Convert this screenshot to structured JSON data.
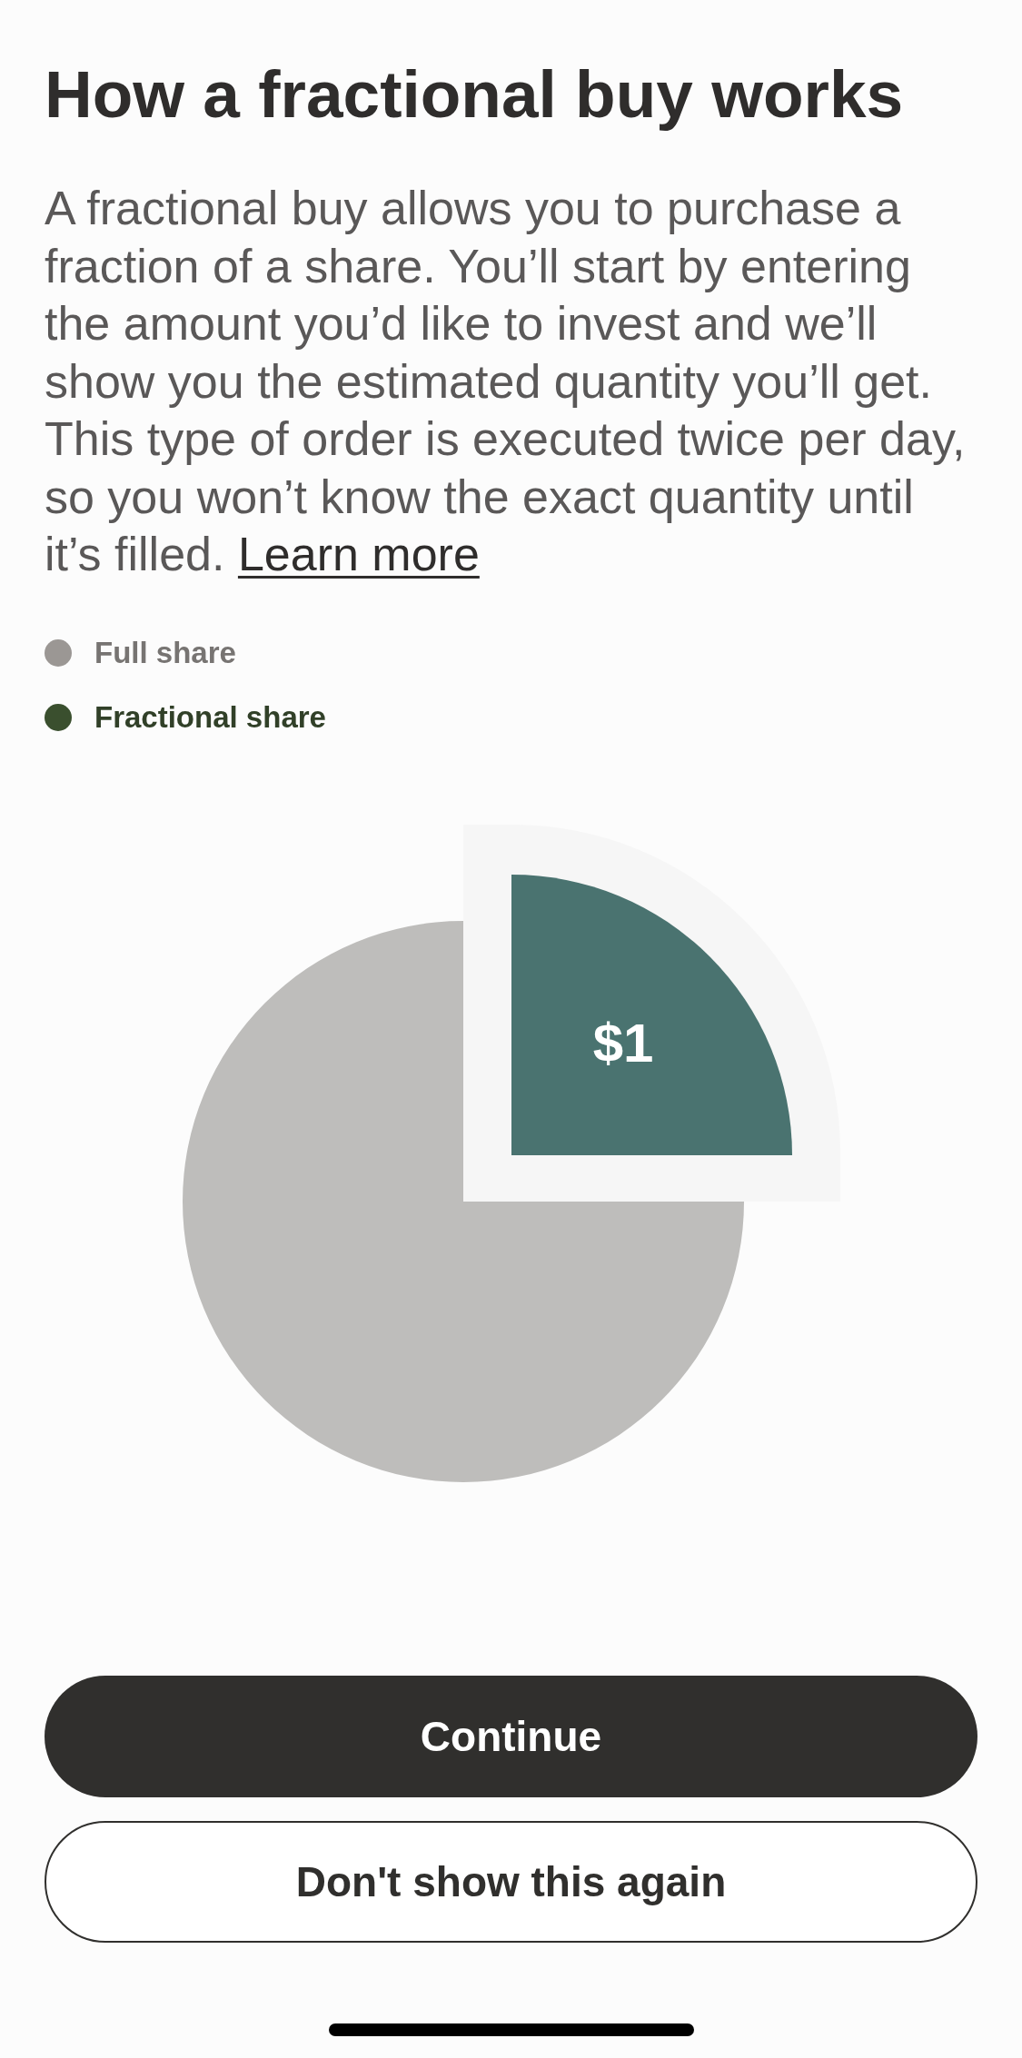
{
  "title": "How a fractional buy works",
  "description": {
    "text": "A fractional buy allows you to purchase a fraction of a share. You’ll start by entering the amount you’d like to invest and we’ll show you the estimated quantity you’ll get. This type of order is executed twice per day, so you won’t know the exact quantity until it’s filled.",
    "link": "Learn more"
  },
  "legend": [
    {
      "label": "Full share",
      "color": "#9b9794"
    },
    {
      "label": "Fractional share",
      "color": "#3a4f2e"
    }
  ],
  "chart": {
    "slice_label": "$1"
  },
  "buttons": [
    {
      "label": "Continue",
      "kind": "primary"
    },
    {
      "label": "Don't show this again",
      "kind": "secondary"
    }
  ]
}
